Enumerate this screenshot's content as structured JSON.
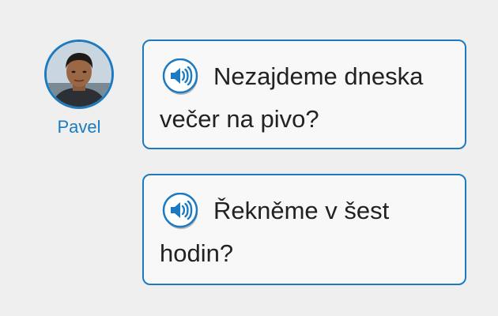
{
  "speaker": {
    "name": "Pavel",
    "avatar_icon": "person-avatar",
    "accent_color": "#1c7bc0"
  },
  "messages": [
    {
      "text": "Nezajdeme dneska večer na pivo?",
      "audio_icon": "speaker-icon"
    },
    {
      "text": "Řekněme v šest hodin?",
      "audio_icon": "speaker-icon"
    }
  ]
}
